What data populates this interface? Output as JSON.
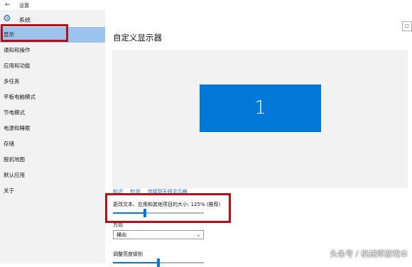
{
  "window": {
    "title": "设置",
    "back_icon": "arrow-left-icon"
  },
  "sidebar": {
    "title": "系统",
    "icon": "gear-icon",
    "items": [
      {
        "label": "显示",
        "selected": true
      },
      {
        "label": "通知和操作",
        "selected": false
      },
      {
        "label": "应用和功能",
        "selected": false
      },
      {
        "label": "多任务",
        "selected": false
      },
      {
        "label": "平板电脑模式",
        "selected": false
      },
      {
        "label": "节电模式",
        "selected": false
      },
      {
        "label": "电源和睡眠",
        "selected": false
      },
      {
        "label": "存储",
        "selected": false
      },
      {
        "label": "脱机地图",
        "selected": false
      },
      {
        "label": "默认应用",
        "selected": false
      },
      {
        "label": "关于",
        "selected": false
      }
    ]
  },
  "main": {
    "title": "自定义显示器",
    "monitor_number": "1",
    "links": [
      "标识",
      "检测",
      "连接到无线显示器"
    ],
    "scale": {
      "label": "更改文本、应用和其他项目的大小: 125% (推荐)",
      "value_fraction": 0.35
    },
    "orientation": {
      "label": "方向",
      "value": "横向"
    },
    "brightness": {
      "label": "调整亮度级别",
      "value_fraction": 0.5
    }
  },
  "watermark": "头条号 / 机械师游戏本",
  "colors": {
    "accent": "#0078d7",
    "selected": "#9cc3ec",
    "highlight": "#b0111b"
  }
}
